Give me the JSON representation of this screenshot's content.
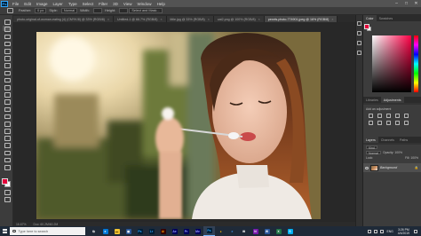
{
  "menubar": {
    "logo": "Ps",
    "items": [
      "File",
      "Edit",
      "Image",
      "Layer",
      "Type",
      "Select",
      "Filter",
      "3D",
      "View",
      "Window",
      "Help"
    ],
    "window_controls": [
      "–",
      "□",
      "✕"
    ]
  },
  "options": {
    "feather_label": "Feather:",
    "feather_value": "0 px",
    "style_label": "Style:",
    "style_value": "Normal",
    "width_label": "Width:",
    "height_label": "Height:",
    "select_mask": "Select and Mask..."
  },
  "tabs": [
    {
      "label": "photo-original-of-woman-eating (4) (CMYK/8) @ 33% (RGB/8)",
      "active": false
    },
    {
      "label": "Untitled-1 @ 66.7% (RGB/8)",
      "active": false
    },
    {
      "label": "little.jpg @ 33% (RGB/8)",
      "active": false
    },
    {
      "label": "cat2.png @ 100% (RGB/8)",
      "active": false
    },
    {
      "label": "pexels-photo-774901.jpeg @ 16% (RGB/8)",
      "active": true
    }
  ],
  "status": {
    "zoom": "16.67%",
    "doc": "Doc: 60.2M/60.2M"
  },
  "colors": {
    "foreground": "#e4003a",
    "background": "#ffffff",
    "accent": "#31a8ff"
  },
  "panels": {
    "color_tabs": [
      "Color",
      "Swatches"
    ],
    "adjust_tabs": [
      "Libraries",
      "Adjustments"
    ],
    "add_adjustment": "Add an adjustment",
    "layer_tabs": [
      "Layers",
      "Channels",
      "Paths"
    ],
    "kind_label": "Kind",
    "blend_mode": "Normal",
    "opacity": "Opacity: 100%",
    "lock_label": "Lock:",
    "fill": "Fill: 100%",
    "layer_name": "Background",
    "lock_icon": "🔒"
  },
  "taskbar": {
    "search_placeholder": "Type here to search",
    "apps": [
      {
        "icon": "task-view-icon",
        "glyph": "⧉",
        "bg": "#1f2a38",
        "fg": "#ffffff"
      },
      {
        "icon": "edge-icon",
        "glyph": "e",
        "bg": "#0078d7",
        "fg": "#ffffff"
      },
      {
        "icon": "file-explorer-icon",
        "glyph": "▬",
        "bg": "#f1c232",
        "fg": "#6b4f00"
      },
      {
        "icon": "store-icon",
        "glyph": "◼",
        "bg": "#2b5797",
        "fg": "#ffffff"
      },
      {
        "icon": "photoshop-icon",
        "glyph": "Ps",
        "bg": "#001e36",
        "fg": "#31a8ff"
      },
      {
        "icon": "lightroom-icon",
        "glyph": "Lr",
        "bg": "#001e36",
        "fg": "#31a8ff"
      },
      {
        "icon": "illustrator-icon",
        "glyph": "Ai",
        "bg": "#330000",
        "fg": "#ff9a00"
      },
      {
        "icon": "after-effects-icon",
        "glyph": "Ae",
        "bg": "#00005b",
        "fg": "#9999ff"
      },
      {
        "icon": "premiere-icon",
        "glyph": "Pr",
        "bg": "#00005b",
        "fg": "#9999ff"
      },
      {
        "icon": "media-encoder-icon",
        "glyph": "Me",
        "bg": "#00005b",
        "fg": "#9999ff"
      },
      {
        "icon": "photoshop-active-icon",
        "glyph": "Ps",
        "bg": "#001e36",
        "fg": "#31a8ff"
      },
      {
        "icon": "chrome-icon",
        "glyph": "●",
        "bg": "#1f2a38",
        "fg": "#f4b400"
      },
      {
        "icon": "edge-alt-icon",
        "glyph": "e",
        "bg": "#1f2a38",
        "fg": "#3c8ee5"
      },
      {
        "icon": "mail-icon",
        "glyph": "✉",
        "bg": "#1f2a38",
        "fg": "#ffffff"
      },
      {
        "icon": "onenote-icon",
        "glyph": "N",
        "bg": "#7719aa",
        "fg": "#ffffff"
      },
      {
        "icon": "word-icon",
        "glyph": "W",
        "bg": "#2b579a",
        "fg": "#ffffff"
      },
      {
        "icon": "excel-icon",
        "glyph": "X",
        "bg": "#217346",
        "fg": "#ffffff"
      },
      {
        "icon": "skype-icon",
        "glyph": "S",
        "bg": "#00aff0",
        "fg": "#ffffff"
      }
    ],
    "lang": "ENG",
    "time": "3:26 PM",
    "date": "4/4/2019"
  }
}
